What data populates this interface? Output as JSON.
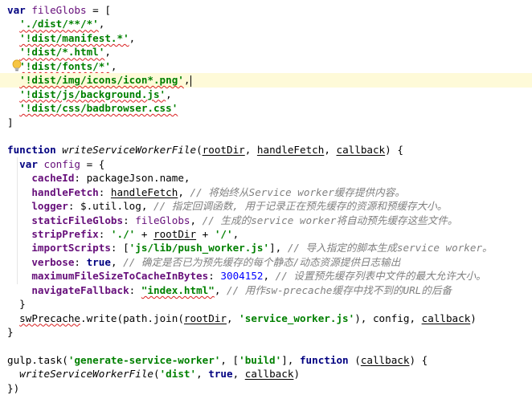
{
  "editor": {
    "lines": [
      [
        {
          "t": "var ",
          "c": "kw"
        },
        {
          "t": "fileGlobs",
          "c": "var"
        },
        {
          "t": " = [",
          "c": "plain"
        }
      ],
      [
        {
          "t": "  ",
          "c": "plain"
        },
        {
          "t": "'./dist/**/*'",
          "c": "str sq"
        },
        {
          "t": ",",
          "c": "plain"
        }
      ],
      [
        {
          "t": "  ",
          "c": "plain"
        },
        {
          "t": "'!dist/manifest.*'",
          "c": "str sq"
        },
        {
          "t": ",",
          "c": "plain"
        }
      ],
      [
        {
          "t": "  ",
          "c": "plain"
        },
        {
          "t": "'!dist/*.html'",
          "c": "str sq"
        },
        {
          "t": ",",
          "c": "plain"
        }
      ],
      [
        {
          "t": "  ",
          "c": "plain"
        },
        {
          "t": "'!dist/fonts/*'",
          "c": "str sq"
        },
        {
          "t": ",",
          "c": "plain"
        }
      ],
      [
        {
          "t": "  ",
          "c": "plain"
        },
        {
          "t": "'!dist/img/icons/icon*.png'",
          "c": "str sq"
        },
        {
          "t": ",",
          "c": "plain"
        }
      ],
      [
        {
          "t": "  ",
          "c": "plain"
        },
        {
          "t": "'!dist/js/background.js'",
          "c": "str sq"
        },
        {
          "t": ",",
          "c": "plain"
        }
      ],
      [
        {
          "t": "  ",
          "c": "plain"
        },
        {
          "t": "'!dist/css/badbrowser.css'",
          "c": "str sq"
        }
      ],
      [
        {
          "t": "]",
          "c": "plain"
        }
      ],
      [],
      [
        {
          "t": "function ",
          "c": "kw"
        },
        {
          "t": "writeServiceWorkerFile",
          "c": "fn"
        },
        {
          "t": "(",
          "c": "plain"
        },
        {
          "t": "rootDir",
          "c": "ul"
        },
        {
          "t": ", ",
          "c": "plain"
        },
        {
          "t": "handleFetch",
          "c": "ul"
        },
        {
          "t": ", ",
          "c": "plain"
        },
        {
          "t": "callback",
          "c": "ul"
        },
        {
          "t": ") {",
          "c": "plain"
        }
      ],
      [
        {
          "t": "  ",
          "c": "plain"
        },
        {
          "t": "var ",
          "c": "kw"
        },
        {
          "t": "config",
          "c": "var"
        },
        {
          "t": " = {",
          "c": "plain"
        }
      ],
      [
        {
          "t": "    ",
          "c": "plain"
        },
        {
          "t": "cacheId",
          "c": "prop"
        },
        {
          "t": ": packageJson.name,",
          "c": "plain"
        }
      ],
      [
        {
          "t": "    ",
          "c": "plain"
        },
        {
          "t": "handleFetch",
          "c": "prop"
        },
        {
          "t": ": ",
          "c": "plain"
        },
        {
          "t": "handleFetch",
          "c": "ul"
        },
        {
          "t": ", ",
          "c": "plain"
        },
        {
          "t": "// 将始终从Service worker缓存提供内容。",
          "c": "cmt"
        }
      ],
      [
        {
          "t": "    ",
          "c": "plain"
        },
        {
          "t": "logger",
          "c": "prop"
        },
        {
          "t": ": $.util.log, ",
          "c": "plain"
        },
        {
          "t": "// 指定回调函数, 用于记录正在预先缓存的资源和预缓存大小。",
          "c": "cmt"
        }
      ],
      [
        {
          "t": "    ",
          "c": "plain"
        },
        {
          "t": "staticFileGlobs",
          "c": "prop"
        },
        {
          "t": ": ",
          "c": "plain"
        },
        {
          "t": "fileGlobs",
          "c": "var"
        },
        {
          "t": ", ",
          "c": "plain"
        },
        {
          "t": "// 生成的service worker将自动预先缓存这些文件。",
          "c": "cmt"
        }
      ],
      [
        {
          "t": "    ",
          "c": "plain"
        },
        {
          "t": "stripPrefix",
          "c": "prop"
        },
        {
          "t": ": ",
          "c": "plain"
        },
        {
          "t": "'./'",
          "c": "str"
        },
        {
          "t": " + ",
          "c": "plain"
        },
        {
          "t": "rootDir",
          "c": "ul"
        },
        {
          "t": " + ",
          "c": "plain"
        },
        {
          "t": "'/'",
          "c": "str"
        },
        {
          "t": ",",
          "c": "plain"
        }
      ],
      [
        {
          "t": "    ",
          "c": "plain"
        },
        {
          "t": "importScripts",
          "c": "prop"
        },
        {
          "t": ": [",
          "c": "plain"
        },
        {
          "t": "'js/lib/push_worker.js'",
          "c": "str"
        },
        {
          "t": "], ",
          "c": "plain"
        },
        {
          "t": "// 导入指定的脚本生成service worker。",
          "c": "cmt"
        }
      ],
      [
        {
          "t": "    ",
          "c": "plain"
        },
        {
          "t": "verbose",
          "c": "prop"
        },
        {
          "t": ": ",
          "c": "plain"
        },
        {
          "t": "true",
          "c": "kw"
        },
        {
          "t": ", ",
          "c": "plain"
        },
        {
          "t": "// 确定是否已为预先缓存的每个静态/动态资源提供日志输出",
          "c": "cmt"
        }
      ],
      [
        {
          "t": "    ",
          "c": "plain"
        },
        {
          "t": "maximumFileSizeToCacheInBytes",
          "c": "prop"
        },
        {
          "t": ": ",
          "c": "plain"
        },
        {
          "t": "3004152",
          "c": "num"
        },
        {
          "t": ", ",
          "c": "plain"
        },
        {
          "t": "// 设置预先缓存列表中文件的最大允许大小。",
          "c": "cmt"
        }
      ],
      [
        {
          "t": "    ",
          "c": "plain"
        },
        {
          "t": "navigateFallback",
          "c": "prop"
        },
        {
          "t": ": ",
          "c": "plain"
        },
        {
          "t": "\"index.html\"",
          "c": "str sq"
        },
        {
          "t": ", ",
          "c": "plain"
        },
        {
          "t": "// 用作sw-precache缓存中找不到的URL的后备",
          "c": "cmt"
        }
      ],
      [
        {
          "t": "  }",
          "c": "plain"
        }
      ],
      [
        {
          "t": "  ",
          "c": "plain"
        },
        {
          "t": "swPrecache",
          "c": "sq"
        },
        {
          "t": ".write(path.join(",
          "c": "plain"
        },
        {
          "t": "rootDir",
          "c": "ul"
        },
        {
          "t": ", ",
          "c": "plain"
        },
        {
          "t": "'service_worker.js'",
          "c": "str"
        },
        {
          "t": "), config, ",
          "c": "plain"
        },
        {
          "t": "callback",
          "c": "ul"
        },
        {
          "t": ")",
          "c": "plain"
        }
      ],
      [
        {
          "t": "}",
          "c": "plain"
        }
      ],
      [],
      [
        {
          "t": "gulp.task(",
          "c": "plain"
        },
        {
          "t": "'generate-service-worker'",
          "c": "str"
        },
        {
          "t": ", [",
          "c": "plain"
        },
        {
          "t": "'build'",
          "c": "str"
        },
        {
          "t": "], ",
          "c": "plain"
        },
        {
          "t": "function ",
          "c": "kw"
        },
        {
          "t": "(",
          "c": "plain"
        },
        {
          "t": "callback",
          "c": "ul"
        },
        {
          "t": ") {",
          "c": "plain"
        }
      ],
      [
        {
          "t": "  ",
          "c": "plain"
        },
        {
          "t": "writeServiceWorkerFile",
          "c": "fn"
        },
        {
          "t": "(",
          "c": "plain"
        },
        {
          "t": "'dist'",
          "c": "str"
        },
        {
          "t": ", ",
          "c": "plain"
        },
        {
          "t": "true",
          "c": "kw"
        },
        {
          "t": ", ",
          "c": "plain"
        },
        {
          "t": "callback",
          "c": "ul"
        },
        {
          "t": ")",
          "c": "plain"
        }
      ],
      [
        {
          "t": "})",
          "c": "plain"
        }
      ]
    ],
    "highlighted_line": 5,
    "caret_line": 5,
    "lightbulb_line": 4
  }
}
